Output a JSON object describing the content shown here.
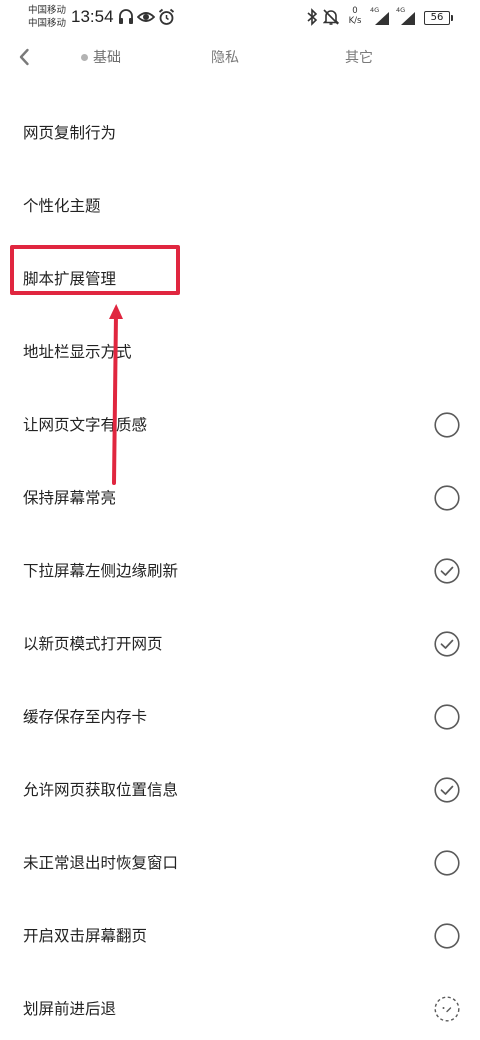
{
  "status_bar": {
    "carrier_1": "中国移动",
    "carrier_2": "中国移动",
    "time": "13:54",
    "net_speed_value": "0",
    "net_speed_unit": "K/s",
    "signal_1_label": "4G",
    "signal_2_label": "4G",
    "battery_level": "56",
    "icons": [
      "headphones-icon",
      "eye-icon",
      "alarm-icon",
      "bluetooth-icon",
      "mute-bell-icon",
      "signal-icon",
      "battery-icon"
    ]
  },
  "header": {
    "back_icon": "chevron-left-icon",
    "tabs": [
      {
        "label": "基础",
        "active": true
      },
      {
        "label": "隐私",
        "active": false
      },
      {
        "label": "其它",
        "active": false
      }
    ]
  },
  "settings": {
    "items": [
      {
        "label": "网页复制行为",
        "control": "none"
      },
      {
        "label": "个性化主题",
        "control": "none"
      },
      {
        "label": "脚本扩展管理",
        "control": "none",
        "highlighted": true
      },
      {
        "label": "地址栏显示方式",
        "control": "none"
      },
      {
        "label": "让网页文字有质感",
        "control": "checkbox",
        "checked": false
      },
      {
        "label": "保持屏幕常亮",
        "control": "checkbox",
        "checked": false
      },
      {
        "label": "下拉屏幕左侧边缘刷新",
        "control": "checkbox",
        "checked": true
      },
      {
        "label": "以新页模式打开网页",
        "control": "checkbox",
        "checked": true
      },
      {
        "label": "缓存保存至内存卡",
        "control": "checkbox",
        "checked": false
      },
      {
        "label": "允许网页获取位置信息",
        "control": "checkbox",
        "checked": true
      },
      {
        "label": "未正常退出时恢复窗口",
        "control": "checkbox",
        "checked": false
      },
      {
        "label": "开启双击屏幕翻页",
        "control": "checkbox",
        "checked": false
      },
      {
        "label": "划屏前进后退",
        "control": "checkbox",
        "checked": false,
        "loading": true
      }
    ]
  },
  "annotation": {
    "color": "#e0263f",
    "target": "脚本扩展管理"
  }
}
